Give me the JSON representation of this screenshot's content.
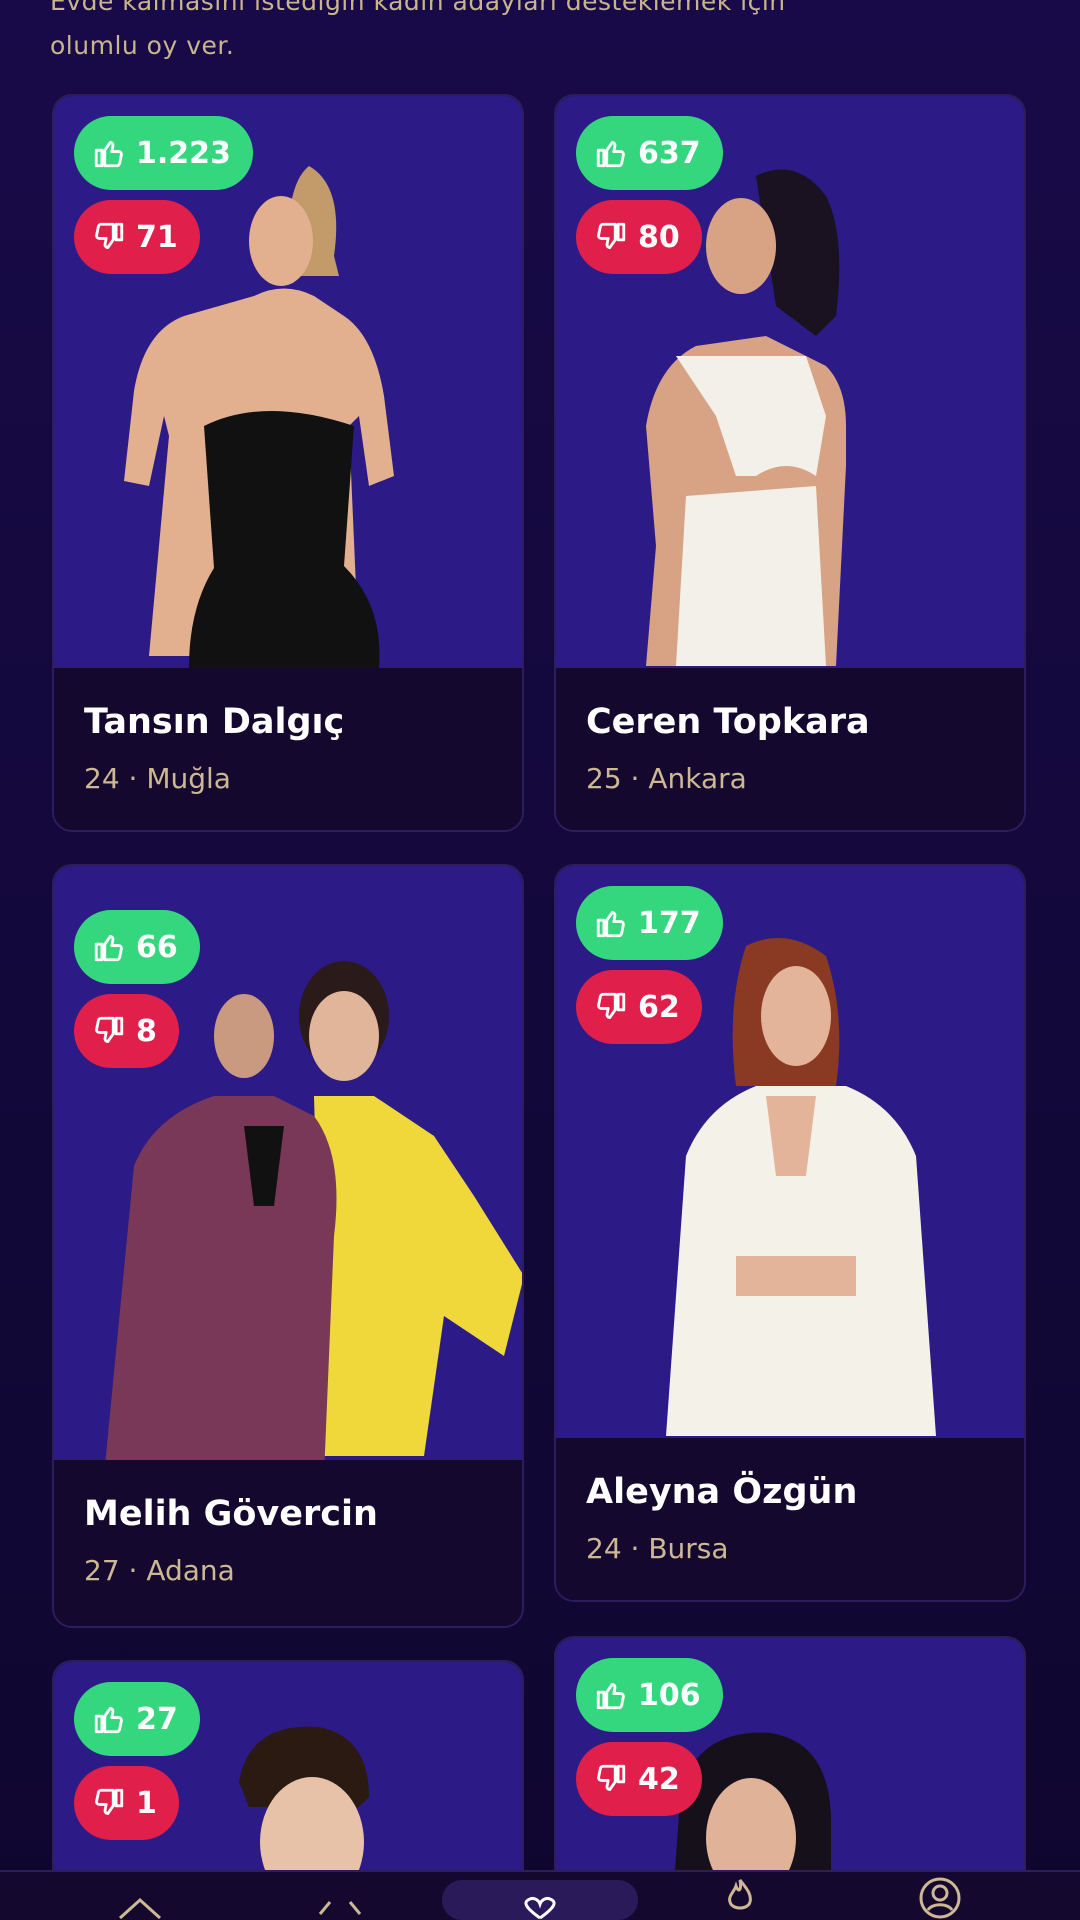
{
  "intro": {
    "line1": "Evde kalmasını istediğin kadın adayları desteklemek için",
    "line2": "olumlu oy ver."
  },
  "cards": [
    {
      "up": "1.223",
      "down": "71",
      "name": "Tansın Dalgıç",
      "meta": "24 · Muğla"
    },
    {
      "up": "637",
      "down": "80",
      "name": "Ceren Topkara",
      "meta": "25 · Ankara"
    },
    {
      "up": "66",
      "down": "8",
      "name": "Melih Gövercin",
      "meta": "27 · Adana"
    },
    {
      "up": "177",
      "down": "62",
      "name": "Aleyna Özgün",
      "meta": "24 · Bursa"
    },
    {
      "up": "27",
      "down": "1"
    },
    {
      "up": "106",
      "down": "42"
    }
  ],
  "colors": {
    "up": "#34d77e",
    "down": "#e0204a",
    "photo_bg": "#2c1b86",
    "card_bg": "#14082f",
    "meta": "#cdb893"
  },
  "nav": {
    "icons": [
      "home-icon",
      "code-icon",
      "heart-icon",
      "flame-icon",
      "profile-icon"
    ]
  }
}
